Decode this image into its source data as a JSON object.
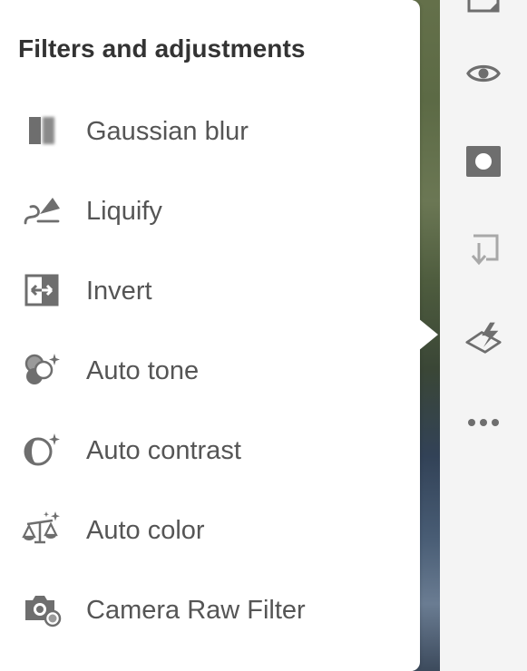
{
  "popover": {
    "title": "Filters and adjustments",
    "items": [
      {
        "label": "Gaussian blur",
        "icon": "gaussian-blur-icon"
      },
      {
        "label": "Liquify",
        "icon": "liquify-icon"
      },
      {
        "label": "Invert",
        "icon": "invert-icon"
      },
      {
        "label": "Auto tone",
        "icon": "auto-tone-icon"
      },
      {
        "label": "Auto contrast",
        "icon": "auto-contrast-icon"
      },
      {
        "label": "Auto color",
        "icon": "auto-color-icon"
      },
      {
        "label": "Camera Raw Filter",
        "icon": "camera-raw-icon"
      }
    ]
  },
  "toolbar": {
    "buttons": [
      {
        "icon": "layer-properties-icon"
      },
      {
        "icon": "eye-icon"
      },
      {
        "icon": "mask-icon"
      },
      {
        "icon": "import-icon"
      },
      {
        "icon": "filters-adjustments-icon"
      },
      {
        "icon": "more-icon"
      }
    ]
  },
  "colors": {
    "icon": "#6e6e6e",
    "label": "#555555",
    "title": "#333333",
    "popover_bg": "#ffffff",
    "toolbar_bg": "#f4f4f4"
  }
}
